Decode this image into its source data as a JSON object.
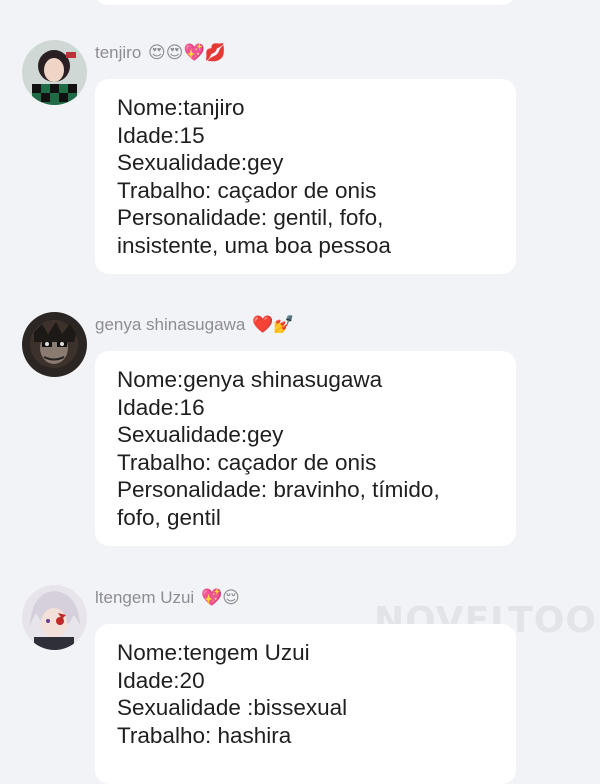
{
  "colors": {
    "background": "#f2f3f6",
    "bubble": "#ffffff",
    "sender_name": "#8d8d92",
    "message_text": "#1f1f1f"
  },
  "watermark": "NOVELTOON",
  "messages": [
    {
      "sender": "tenjiro",
      "emojis": "😍😍💖💋",
      "lines": [
        "Nome:tanjiro",
        "Idade:15",
        "Sexualidade:gey",
        "Trabalho: caçador de onis",
        "Personalidade: gentil, fofo,",
        "insistente, uma boa pessoa"
      ]
    },
    {
      "sender": "genya shinasugawa",
      "emojis": "❤️💅",
      "lines": [
        "Nome:genya shinasugawa",
        "Idade:16",
        "Sexualidade:gey",
        "Trabalho: caçador de onis",
        "Personalidade: bravinho, tímido,",
        "fofo, gentil"
      ]
    },
    {
      "sender": "ltengem Uzui",
      "emojis": "💖😌",
      "lines": [
        "Nome:tengem Uzui",
        "Idade:20",
        "Sexualidade :bissexual",
        "Trabalho: hashira"
      ]
    }
  ]
}
